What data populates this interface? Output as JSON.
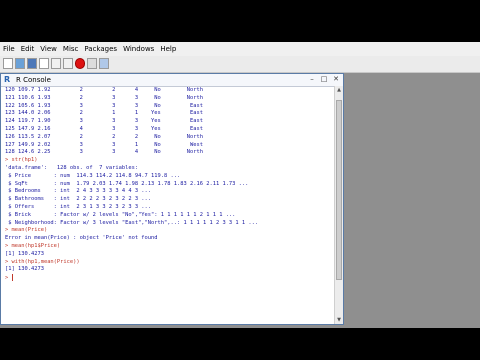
{
  "menu": [
    "File",
    "Edit",
    "View",
    "Misc",
    "Packages",
    "Windows",
    "Help"
  ],
  "toolbar_icons": [
    "open-script-icon",
    "load-workspace-icon",
    "save-workspace-icon",
    "copy-icon",
    "paste-icon",
    "copy-paste-icon",
    "stop-icon",
    "print-icon",
    "help-icon"
  ],
  "console": {
    "title": "R Console",
    "lines": [
      {
        "kind": "out",
        "text": "120 109.7 1.92         2         2      4     No        North"
      },
      {
        "kind": "out",
        "text": "121 110.6 1.93         2         3      3     No        North"
      },
      {
        "kind": "out",
        "text": "122 105.6 1.93         3         3      3     No         East"
      },
      {
        "kind": "out",
        "text": "123 144.0 2.06         2         1      1    Yes         East"
      },
      {
        "kind": "out",
        "text": "124 119.7 1.90         3         3      3    Yes         East"
      },
      {
        "kind": "out",
        "text": "125 147.9 2.16         4         3      3    Yes         East"
      },
      {
        "kind": "out",
        "text": "126 113.5 2.07         2         2      2     No        North"
      },
      {
        "kind": "out",
        "text": "127 149.9 2.02         3         3      1     No         West"
      },
      {
        "kind": "out",
        "text": "128 124.6 2.25         3         3      4     No        North"
      },
      {
        "kind": "cmd",
        "text": "> str(hp1)"
      },
      {
        "kind": "out",
        "text": "'data.frame':   128 obs. of  7 variables:"
      },
      {
        "kind": "out",
        "text": " $ Price       : num  114.3 114.2 114.8 94.7 119.8 ..."
      },
      {
        "kind": "out",
        "text": " $ SqFt        : num  1.79 2.03 1.74 1.98 2.13 1.78 1.83 2.16 2.11 1.73 ..."
      },
      {
        "kind": "out",
        "text": " $ Bedrooms    : int  2 4 3 3 3 3 3 4 4 3 ..."
      },
      {
        "kind": "out",
        "text": " $ Bathrooms   : int  2 2 2 2 3 2 3 2 2 3 ..."
      },
      {
        "kind": "out",
        "text": " $ Offers      : int  2 3 1 3 3 2 3 2 3 3 ..."
      },
      {
        "kind": "out",
        "text": " $ Brick       : Factor w/ 2 levels \"No\",\"Yes\": 1 1 1 1 1 1 2 1 1 1 ..."
      },
      {
        "kind": "out",
        "text": " $ Neighborhood: Factor w/ 3 levels \"East\",\"North\",..: 1 1 1 1 1 2 3 3 1 1 ..."
      },
      {
        "kind": "cmd",
        "text": "> mean(Price)"
      },
      {
        "kind": "out",
        "text": "Error in mean(Price) : object 'Price' not found"
      },
      {
        "kind": "cmd",
        "text": "> mean(hp1$Price)"
      },
      {
        "kind": "out",
        "text": "[1] 130.4273"
      },
      {
        "kind": "cmd",
        "text": "> with(hp1,mean(Price))"
      },
      {
        "kind": "out",
        "text": "[1] 130.4273"
      }
    ],
    "prompt": "> "
  },
  "colors": {
    "output": "#1a1aa0",
    "command": "#c0392b",
    "background": "#ffffff"
  }
}
